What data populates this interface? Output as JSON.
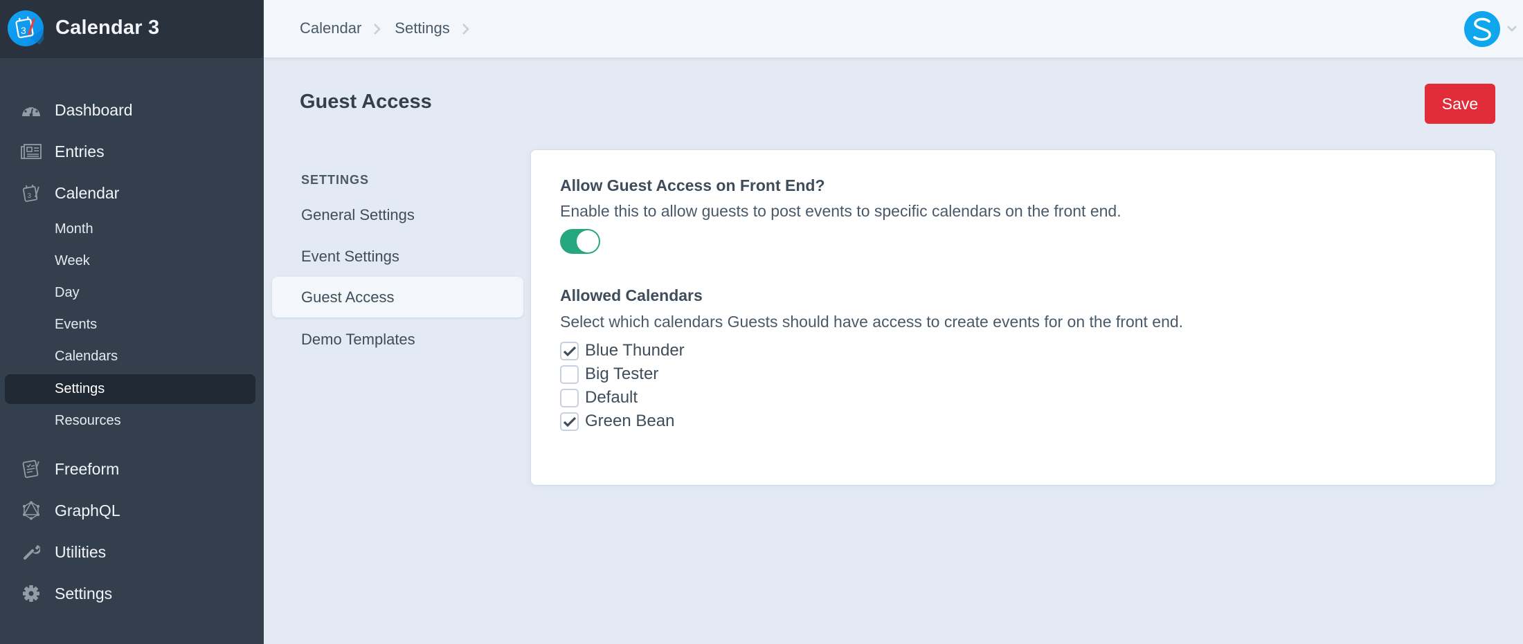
{
  "app": {
    "title": "Calendar 3",
    "logo_icon": "calendar-3-logo-icon"
  },
  "sidebar": {
    "nav": [
      {
        "label": "Dashboard",
        "icon": "dashboard-gauge-icon"
      },
      {
        "label": "Entries",
        "icon": "newspaper-icon"
      },
      {
        "label": "Calendar",
        "icon": "calendar-icon"
      }
    ],
    "calendar_subitems": [
      {
        "label": "Month",
        "active": false
      },
      {
        "label": "Week",
        "active": false
      },
      {
        "label": "Day",
        "active": false
      },
      {
        "label": "Events",
        "active": false
      },
      {
        "label": "Calendars",
        "active": false
      },
      {
        "label": "Settings",
        "active": true
      },
      {
        "label": "Resources",
        "active": false
      }
    ],
    "nav_bottom": [
      {
        "label": "Freeform",
        "icon": "freeform-form-icon"
      },
      {
        "label": "GraphQL",
        "icon": "graphql-icon"
      },
      {
        "label": "Utilities",
        "icon": "wrench-icon"
      },
      {
        "label": "Settings",
        "icon": "gear-icon"
      }
    ]
  },
  "topbar": {
    "breadcrumb": [
      "Calendar",
      "Settings"
    ],
    "user_initial": "S"
  },
  "page": {
    "title": "Guest Access",
    "save_label": "Save"
  },
  "subnav": {
    "heading": "SETTINGS",
    "items": [
      {
        "label": "General Settings",
        "active": false
      },
      {
        "label": "Event Settings",
        "active": false
      },
      {
        "label": "Guest Access",
        "active": true
      },
      {
        "label": "Demo Templates",
        "active": false
      }
    ]
  },
  "form": {
    "guest_access": {
      "heading": "Allow Guest Access on Front End?",
      "description": "Enable this to allow guests to post events to specific calendars on the front end.",
      "enabled": true
    },
    "allowed_calendars": {
      "heading": "Allowed Calendars",
      "description": "Select which calendars Guests should have access to create events for on the front end.",
      "options": [
        {
          "label": "Blue Thunder",
          "checked": true
        },
        {
          "label": "Big Tester",
          "checked": false
        },
        {
          "label": "Default",
          "checked": false
        },
        {
          "label": "Green Bean",
          "checked": true
        }
      ]
    }
  },
  "colors": {
    "sidebar_bg": "#343f4d",
    "sidebar_header_bg": "#29323d",
    "save_button": "#e12d39",
    "toggle_on": "#27a77e",
    "avatar": "#0fa6ee",
    "main_bg": "#e4eaf4"
  }
}
